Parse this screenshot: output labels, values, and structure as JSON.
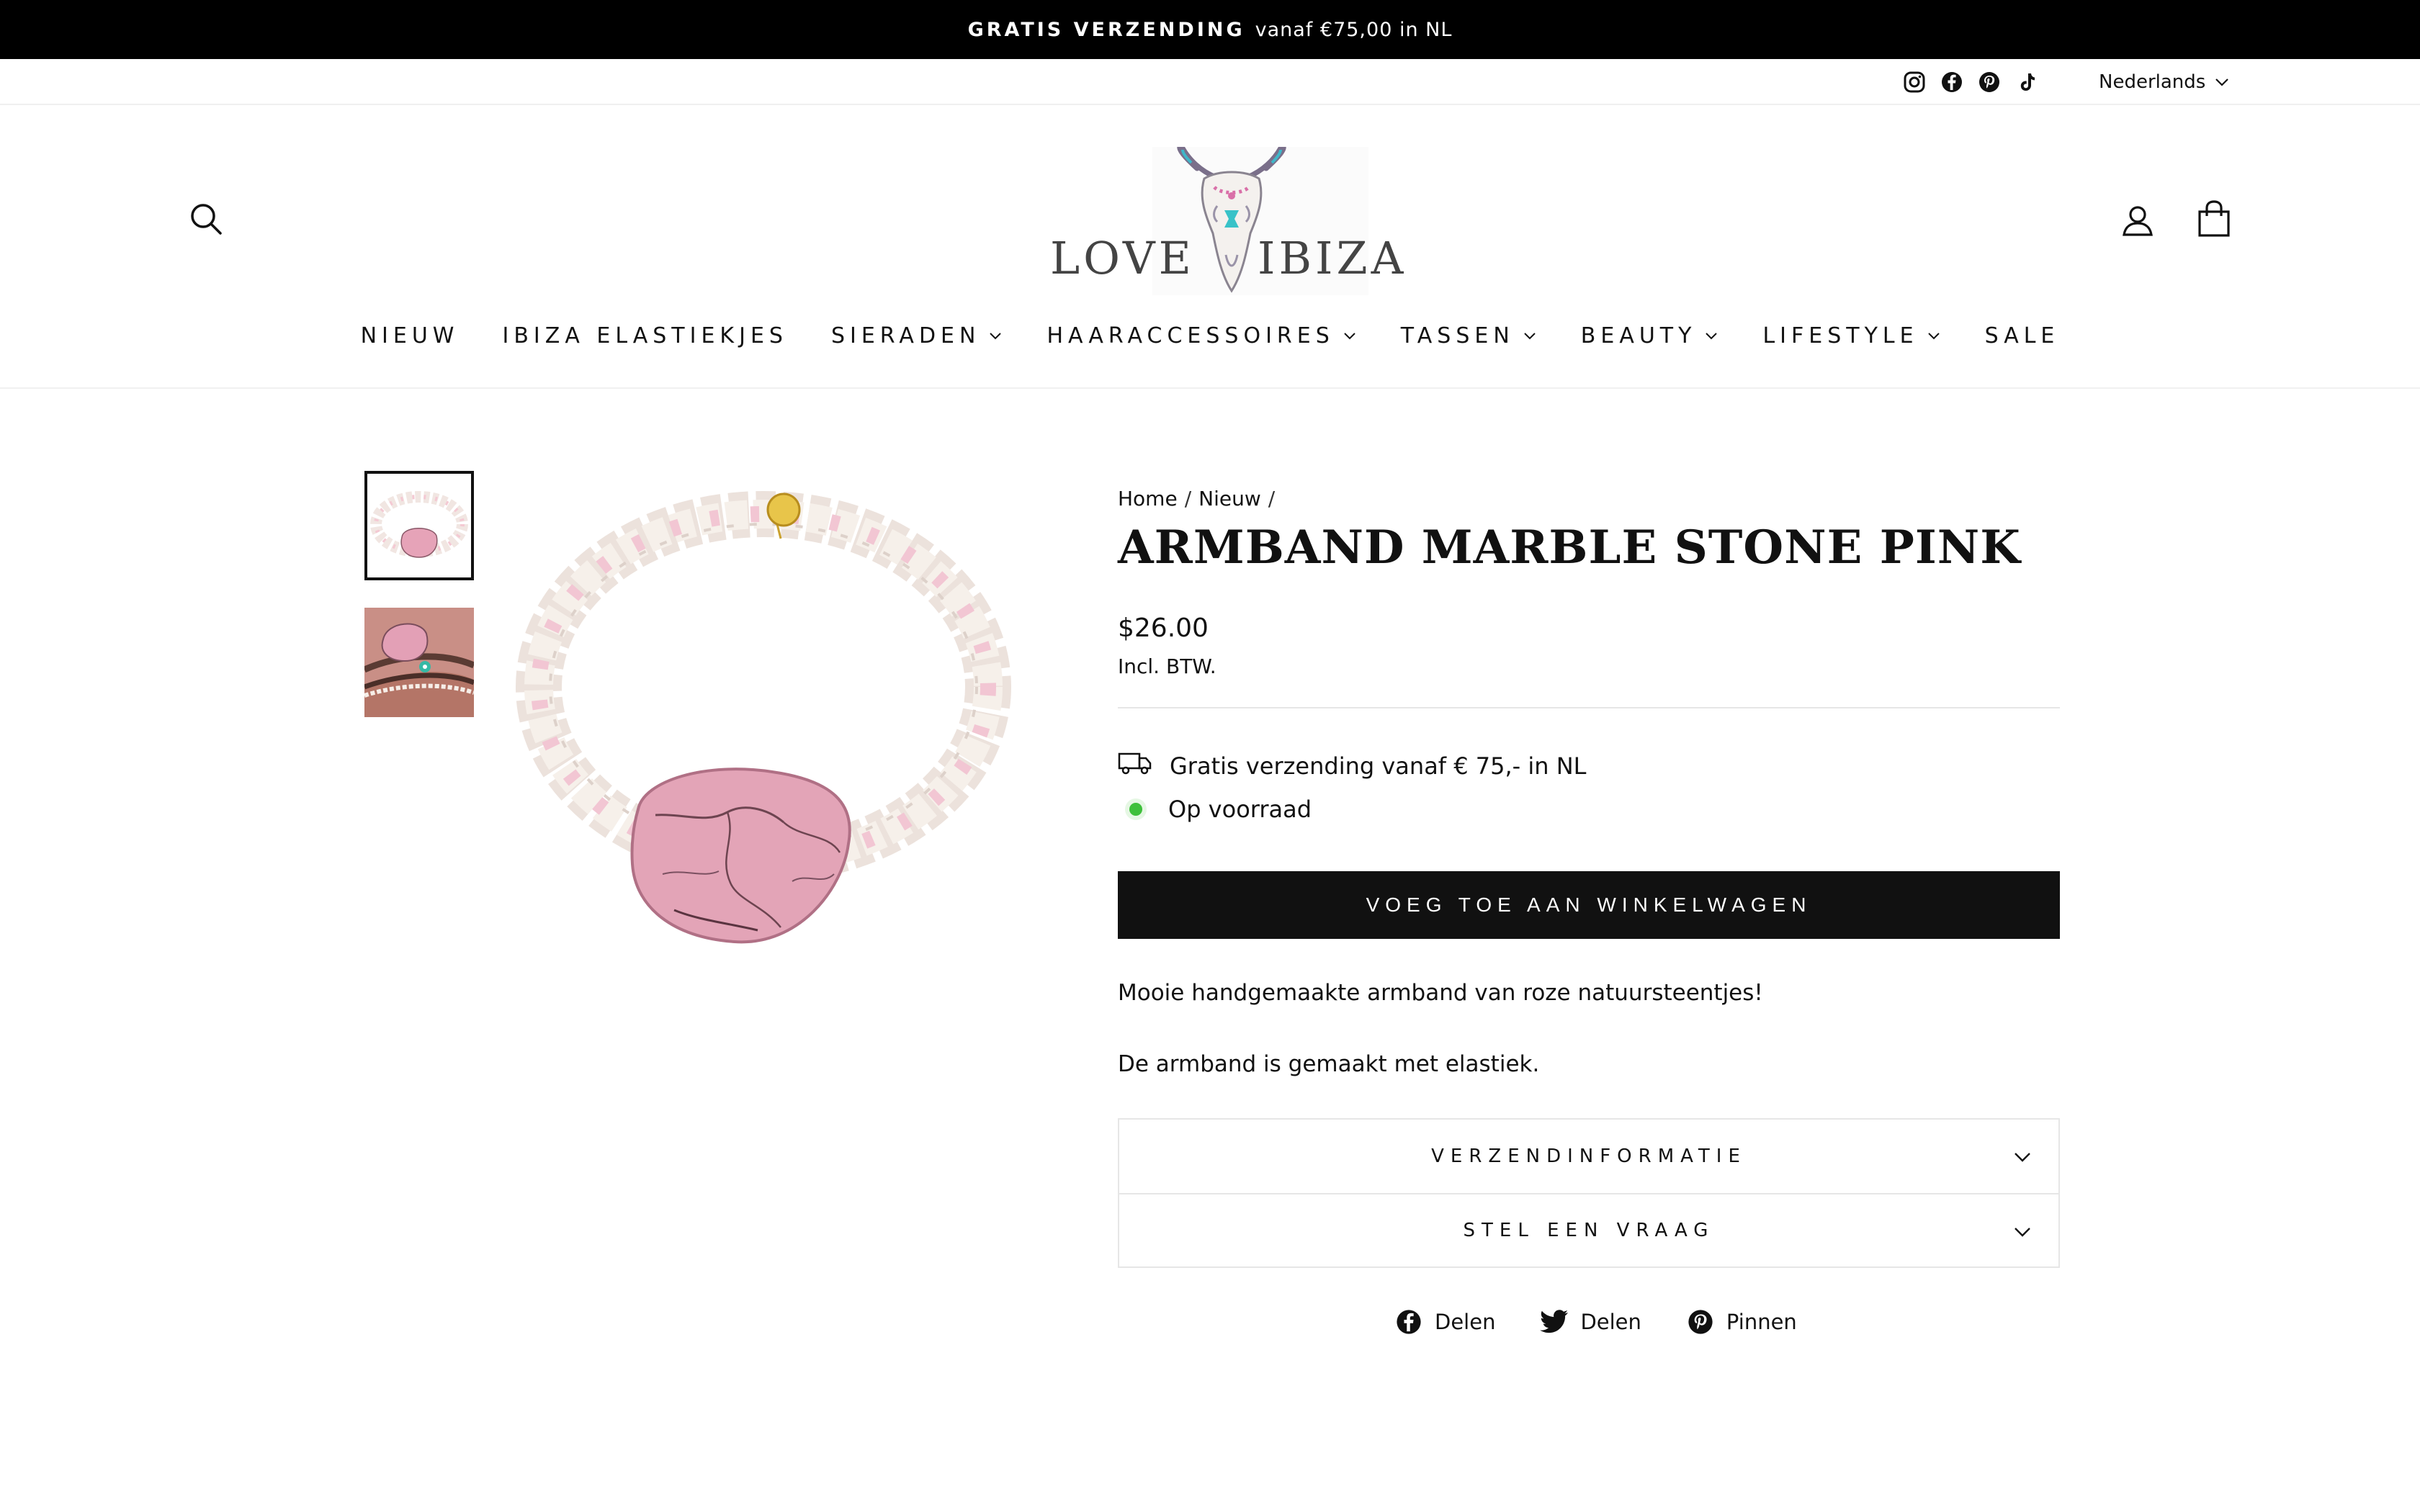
{
  "announcement": {
    "strong": "GRATIS VERZENDING",
    "text": "vanaf €75,00 in NL"
  },
  "utility": {
    "social_icons": [
      "instagram-icon",
      "facebook-icon",
      "pinterest-icon",
      "tiktok-icon"
    ],
    "language": "Nederlands"
  },
  "header": {
    "logo": {
      "left": "LOVE",
      "right": "IBIZA"
    },
    "nav": [
      {
        "label": "NIEUW",
        "dropdown": false
      },
      {
        "label": "IBIZA ELASTIEKJES",
        "dropdown": false
      },
      {
        "label": "SIERADEN",
        "dropdown": true
      },
      {
        "label": "HAARACCESSOIRES",
        "dropdown": true
      },
      {
        "label": "TASSEN",
        "dropdown": true
      },
      {
        "label": "BEAUTY",
        "dropdown": true
      },
      {
        "label": "LIFESTYLE",
        "dropdown": true
      },
      {
        "label": "SALE",
        "dropdown": false
      }
    ]
  },
  "product": {
    "breadcrumb": [
      "Home",
      "Nieuw"
    ],
    "title": "ARMBAND MARBLE STONE PINK",
    "price": "$26.00",
    "tax_note": "Incl. BTW.",
    "shipping_note": "Gratis verzending vanaf € 75,- in NL",
    "stock_status": "Op voorraad",
    "add_to_cart": "VOEG TOE AAN WINKELWAGEN",
    "description": [
      "Mooie handgemaakte armband van roze natuursteentjes!",
      "De armband is gemaakt met elastiek."
    ],
    "accordion": [
      "VERZENDINFORMATIE",
      "STEL EEN VRAAG"
    ],
    "share": [
      {
        "label": "Delen",
        "icon": "facebook-icon"
      },
      {
        "label": "Delen",
        "icon": "twitter-icon"
      },
      {
        "label": "Pinnen",
        "icon": "pinterest-icon"
      }
    ]
  },
  "colors": {
    "black": "#000000",
    "button": "#111111",
    "stock_dot": "#3ec03b",
    "stone_pink": "#e6a3b8"
  }
}
